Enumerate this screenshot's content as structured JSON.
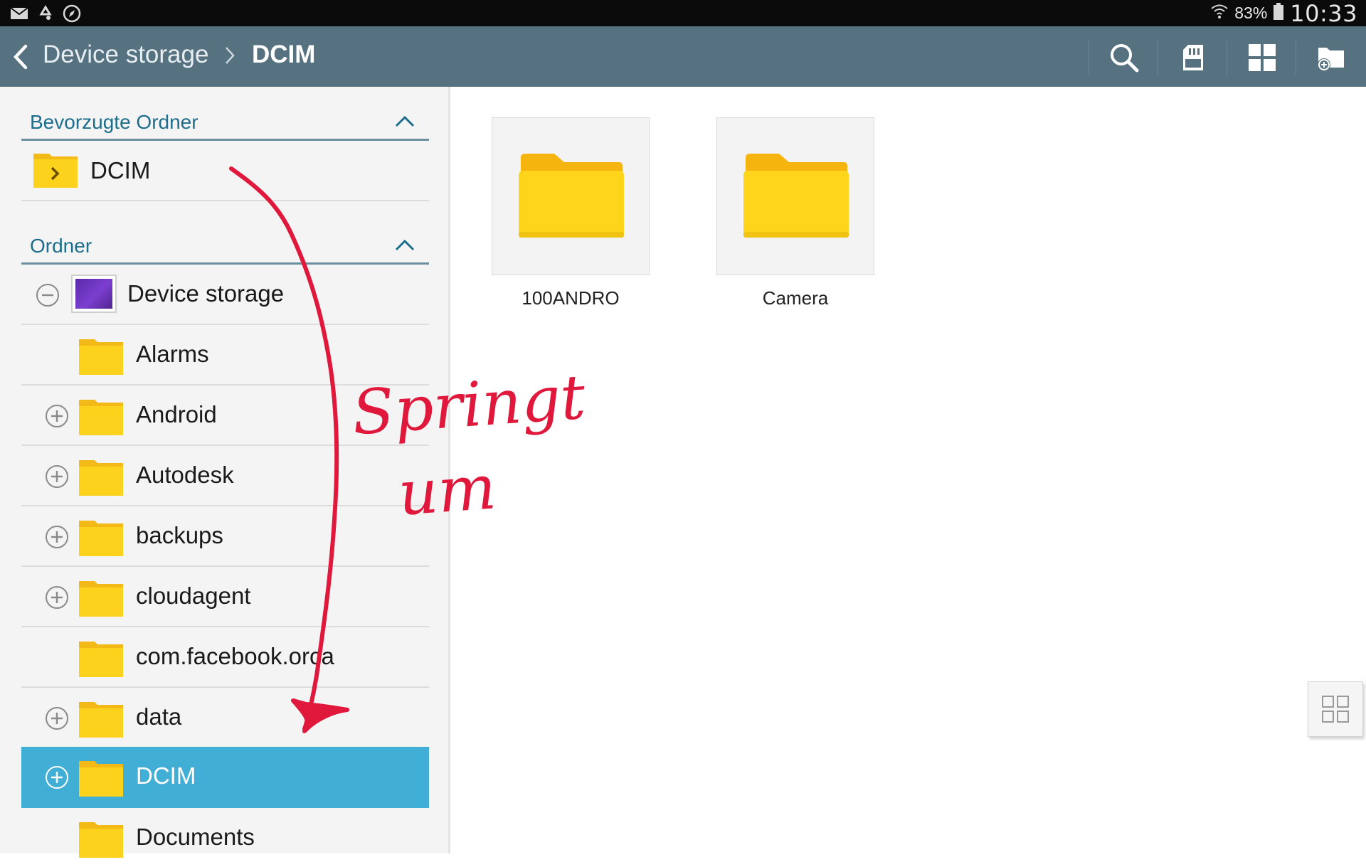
{
  "status_bar": {
    "battery_percent": "83%",
    "clock": "10:33",
    "left_icons": [
      "mail-icon",
      "recycle-icon",
      "compass-icon"
    ],
    "right_icons": [
      "wifi-icon",
      "battery-icon"
    ]
  },
  "action_bar": {
    "breadcrumb": [
      "Device storage",
      "DCIM"
    ],
    "buttons": [
      "search-icon",
      "sd-card-icon",
      "grid-view-icon",
      "new-folder-icon"
    ],
    "color": "#56717f"
  },
  "sidebar": {
    "favorites_header": "Bevorzugte Ordner",
    "favorites": [
      {
        "label": "DCIM"
      }
    ],
    "folders_header": "Ordner",
    "tree": [
      {
        "label": "Device storage",
        "toggle": "collapse",
        "type": "storage"
      },
      {
        "label": "Alarms",
        "toggle": "none"
      },
      {
        "label": "Android",
        "toggle": "expand"
      },
      {
        "label": "Autodesk",
        "toggle": "expand"
      },
      {
        "label": "backups",
        "toggle": "expand"
      },
      {
        "label": "cloudagent",
        "toggle": "expand"
      },
      {
        "label": "com.facebook.orca",
        "toggle": "none"
      },
      {
        "label": "data",
        "toggle": "expand"
      },
      {
        "label": "DCIM",
        "toggle": "expand",
        "selected": true
      },
      {
        "label": "Documents",
        "toggle": "none"
      }
    ],
    "selected_color": "#40aed5"
  },
  "content": {
    "folders": [
      {
        "label": "100ANDRO"
      },
      {
        "label": "Camera"
      }
    ]
  },
  "annotation": {
    "text_line1": "Springt",
    "text_line2": "um",
    "color": "#e0183c"
  }
}
